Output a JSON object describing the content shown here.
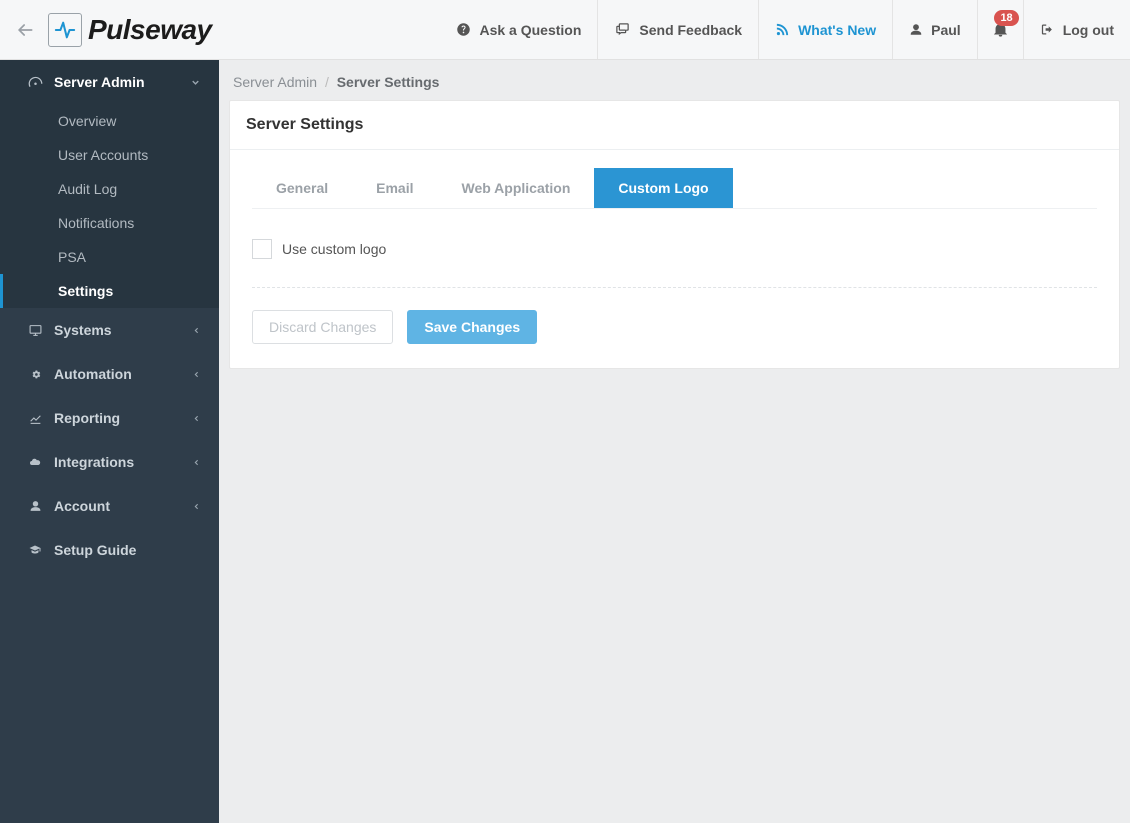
{
  "brand": {
    "name": "Pulseway"
  },
  "topnav": {
    "ask": "Ask a Question",
    "feedback": "Send Feedback",
    "whatsnew": "What's New",
    "user": "Paul",
    "logout": "Log out",
    "notif_count": "18"
  },
  "sidebar": {
    "serverAdmin": "Server Admin",
    "sub": {
      "overview": "Overview",
      "userAccounts": "User Accounts",
      "auditLog": "Audit Log",
      "notifications": "Notifications",
      "psa": "PSA",
      "settings": "Settings"
    },
    "systems": "Systems",
    "automation": "Automation",
    "reporting": "Reporting",
    "integrations": "Integrations",
    "account": "Account",
    "setupGuide": "Setup Guide"
  },
  "breadcrumb": {
    "root": "Server Admin",
    "current": "Server Settings"
  },
  "panel": {
    "title": "Server Settings",
    "tabs": {
      "general": "General",
      "email": "Email",
      "webApp": "Web Application",
      "customLogo": "Custom Logo"
    },
    "checkbox": {
      "label": "Use custom logo"
    },
    "buttons": {
      "discard": "Discard Changes",
      "save": "Save Changes"
    }
  }
}
